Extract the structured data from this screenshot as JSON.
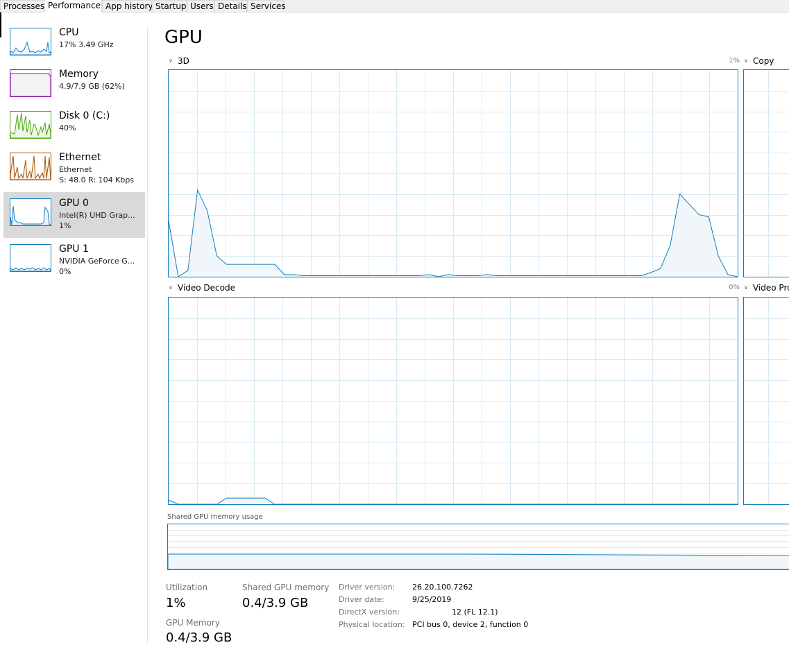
{
  "tabs": [
    "Processes",
    "Performance",
    "App history",
    "Startup",
    "Users",
    "Details",
    "Services"
  ],
  "active_tab": "Performance",
  "sidebar": {
    "items": [
      {
        "title": "CPU",
        "line1": "17% 3.49 GHz",
        "line2": "",
        "color": "#117dbb",
        "fill": "#f1f6fa",
        "selected": false
      },
      {
        "title": "Memory",
        "line1": "4.9/7.9 GB (62%)",
        "line2": "",
        "color": "#8b12ae",
        "fill": "#f4f2f4",
        "selected": false
      },
      {
        "title": "Disk 0 (C:)",
        "line1": "40%",
        "line2": "",
        "color": "#4da60c",
        "fill": "#eff7e9",
        "selected": false
      },
      {
        "title": "Ethernet",
        "line1": "Ethernet",
        "line2": "S: 48.0  R: 104 Kbps",
        "color": "#a74f01",
        "fill": "#fcf3eb",
        "selected": false
      },
      {
        "title": "GPU 0",
        "line1": "Intel(R) UHD Grap...",
        "line2": "1%",
        "color": "#117dbb",
        "fill": "#f1f6fa",
        "selected": true
      },
      {
        "title": "GPU 1",
        "line1": "NVIDIA GeForce G...",
        "line2": "0%",
        "color": "#117dbb",
        "fill": "#f1f6fa",
        "selected": false
      }
    ]
  },
  "main": {
    "title": "GPU",
    "graphs": [
      {
        "label": "3D",
        "max": "1%"
      },
      {
        "label": "Copy",
        "max": ""
      },
      {
        "label": "Video Decode",
        "max": "0%"
      },
      {
        "label": "Video Pro",
        "max": ""
      }
    ],
    "shared_memory_label": "Shared GPU memory usage"
  },
  "stats": {
    "utilization_label": "Utilization",
    "utilization_value": "1%",
    "shared_label": "Shared GPU memory",
    "shared_value": "0.4/3.9 GB",
    "gpu_memory_label": "GPU Memory",
    "gpu_memory_value": "0.4/3.9 GB"
  },
  "info": {
    "driver_version_key": "Driver version:",
    "driver_version": "26.20.100.7262",
    "driver_date_key": "Driver date:",
    "driver_date": "9/25/2019",
    "directx_key": "DirectX version:",
    "directx": "12 (FL 12.1)",
    "location_key": "Physical location:",
    "location": "PCI bus 0, device 2, function 0"
  },
  "colors": {
    "accent": "#117dbb",
    "selection": "#d9d9d9",
    "grid": "#d9eaf4"
  },
  "chart_data": [
    {
      "type": "area",
      "series": [
        {
          "values": [
            27,
            0,
            3,
            42,
            32,
            10,
            6,
            6,
            6,
            6,
            6,
            6,
            1,
            1,
            0.5,
            0.5,
            0.5,
            0.5,
            0.5,
            0.5,
            0.5,
            0.5,
            0.5,
            0.5,
            0.5,
            0.5,
            0.5,
            1,
            0,
            1,
            0.5,
            0.5,
            0.5,
            1,
            0.5,
            0.5,
            0.5,
            0.5,
            0.5,
            0.5,
            0.5,
            0.5,
            0.5,
            0.5,
            0.5,
            0.5,
            0.5,
            0.5,
            0.5,
            0.5,
            2,
            4,
            15,
            40,
            35,
            30,
            29,
            10,
            1,
            0
          ]
        }
      ],
      "ylim": [
        0,
        100
      ]
    },
    {
      "type": "area",
      "series": [
        {
          "values": [
            2,
            0,
            0,
            0,
            0,
            0,
            3,
            3,
            3,
            3,
            3,
            0,
            0,
            0,
            0,
            0,
            0,
            0,
            0,
            0,
            0,
            0,
            0,
            0,
            0,
            0,
            0,
            0,
            0,
            0,
            0,
            0,
            0,
            0,
            0,
            0,
            0,
            0,
            0,
            0,
            0,
            0,
            0,
            0,
            0,
            0,
            0,
            0,
            0,
            0,
            0,
            0,
            0,
            0,
            0,
            0,
            0,
            0,
            0,
            0
          ]
        }
      ],
      "ylim": [
        0,
        100
      ]
    }
  ]
}
